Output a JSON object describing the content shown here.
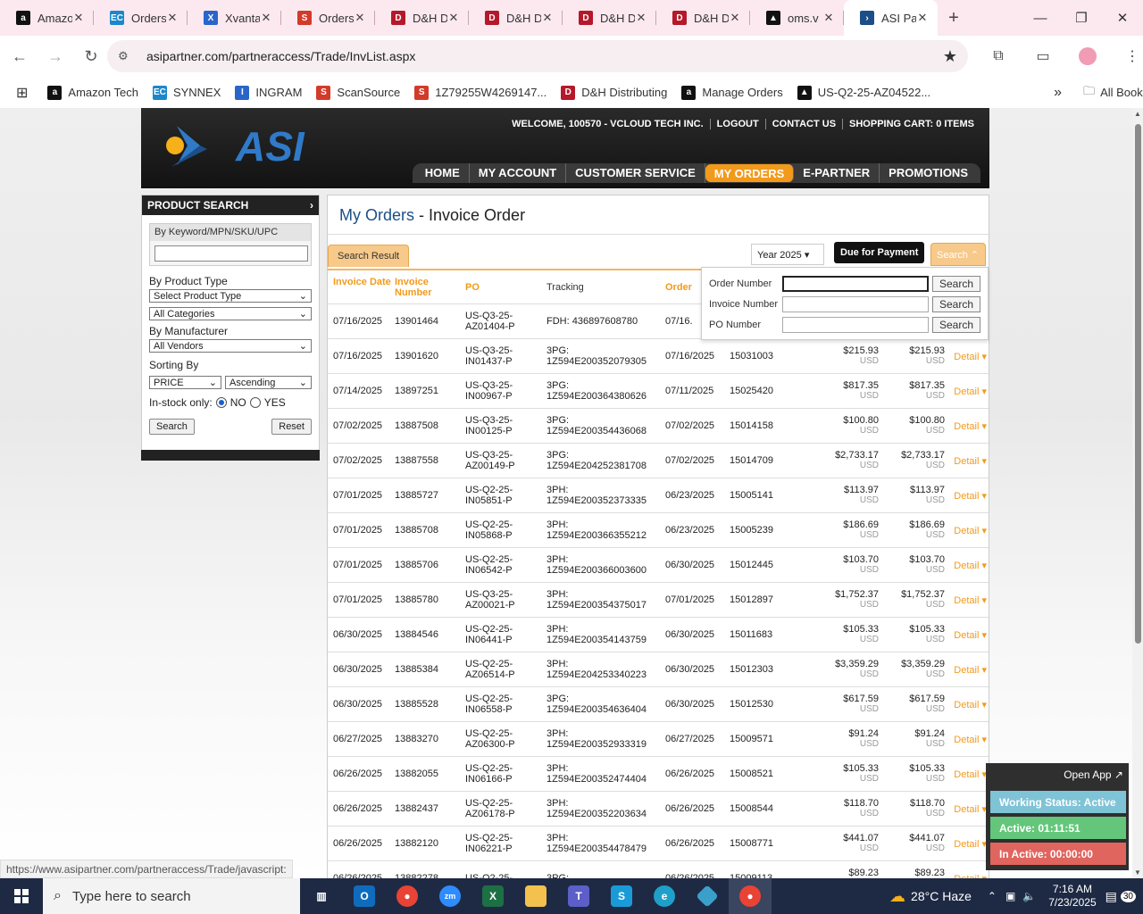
{
  "browser": {
    "tabs": [
      {
        "label": "Amazon",
        "icon": "amazon-icon",
        "color": "#111111",
        "glyph": "a"
      },
      {
        "label": "Orders",
        "icon": "ec-icon",
        "color": "#1d87c9",
        "glyph": "EC"
      },
      {
        "label": "Xvantage",
        "icon": "ingram-icon",
        "color": "#2a65c9",
        "glyph": "X"
      },
      {
        "label": "Orders",
        "icon": "scansource-icon",
        "color": "#d23b2a",
        "glyph": "S"
      },
      {
        "label": "D&H D",
        "icon": "dh-icon",
        "color": "#b5182a",
        "glyph": "D"
      },
      {
        "label": "D&H D",
        "icon": "dh-icon",
        "color": "#b5182a",
        "glyph": "D"
      },
      {
        "label": "D&H D",
        "icon": "dh-icon",
        "color": "#b5182a",
        "glyph": "D"
      },
      {
        "label": "D&H D",
        "icon": "dh-icon",
        "color": "#b5182a",
        "glyph": "D"
      },
      {
        "label": "oms.v",
        "icon": "oms-icon",
        "color": "#111111",
        "glyph": "▲"
      },
      {
        "label": "ASI Pa",
        "icon": "asi-icon",
        "color": "#1c4f87",
        "glyph": "›"
      }
    ],
    "url": "asipartner.com/partneraccess/Trade/InvList.aspx",
    "bookmarks": [
      {
        "label": "Amazon Tech",
        "color": "#111111",
        "glyph": "a"
      },
      {
        "label": "SYNNEX",
        "color": "#1d87c9",
        "glyph": "EC"
      },
      {
        "label": "INGRAM",
        "color": "#2a65c9",
        "glyph": "I"
      },
      {
        "label": "ScanSource",
        "color": "#d23b2a",
        "glyph": "S"
      },
      {
        "label": "1Z79255W4269147...",
        "color": "#d23b2a",
        "glyph": "S"
      },
      {
        "label": "D&H Distributing",
        "color": "#b5182a",
        "glyph": "D"
      },
      {
        "label": "Manage Orders",
        "color": "#111111",
        "glyph": "a"
      },
      {
        "label": "US-Q2-25-AZ04522...",
        "color": "#111111",
        "glyph": "▲"
      }
    ],
    "all_bookmarks": "All Bookmarks",
    "status_url": "https://www.asipartner.com/partneraccess/Trade/javascript:"
  },
  "header": {
    "logo_text": "ASI",
    "welcome": "WELCOME, 100570 - VCLOUD TECH INC.",
    "logout": "LOGOUT",
    "contact": "CONTACT US",
    "cart": "SHOPPING CART: 0 ITEMS",
    "nav": [
      "HOME",
      "MY ACCOUNT",
      "CUSTOMER SERVICE",
      "MY ORDERS",
      "E-PARTNER",
      "PROMOTIONS"
    ]
  },
  "sidebar": {
    "title": "PRODUCT SEARCH",
    "keyword_label": "By Keyword/MPN/SKU/UPC",
    "product_type_label": "By Product Type",
    "product_type_value": "Select Product Type",
    "category_value": "All Categories",
    "manufacturer_label": "By Manufacturer",
    "manufacturer_value": "All Vendors",
    "sorting_label": "Sorting By",
    "sort_field": "PRICE",
    "sort_order": "Ascending",
    "instock_label": "In-stock only:",
    "no_label": "NO",
    "yes_label": "YES",
    "search_btn": "Search",
    "reset_btn": "Reset"
  },
  "main": {
    "title_link": "My Orders",
    "title_sep": " - ",
    "title_rest": "Invoice Order",
    "result_tab": "Search Result",
    "year": "Year 2025",
    "due_btn": "Due for Payment",
    "search_tab": "Search",
    "columns": [
      "Invoice Date",
      "Invoice Number",
      "PO",
      "Tracking",
      "Order"
    ],
    "dropdown": {
      "order_label": "Order Number",
      "invoice_label": "Invoice Number",
      "po_label": "PO Number",
      "search": "Search"
    },
    "currency": "USD",
    "detail": "Detail",
    "rows": [
      {
        "date": "07/16/2025",
        "inv": "13901464",
        "po1": "US-Q3-25-",
        "po2": "AZ01404-P",
        "tr1": "FDH: 436897608780",
        "tr2": "",
        "odate": "07/16.",
        "ord": "",
        "amt": "",
        "amt2": ""
      },
      {
        "date": "07/16/2025",
        "inv": "13901620",
        "po1": "US-Q3-25-",
        "po2": "IN01437-P",
        "tr1": "3PG:",
        "tr2": "1Z594E200352079305",
        "odate": "07/16/2025",
        "ord": "15031003",
        "amt": "$215.93",
        "amt2": "$215.93"
      },
      {
        "date": "07/14/2025",
        "inv": "13897251",
        "po1": "US-Q3-25-",
        "po2": "IN00967-P",
        "tr1": "3PG:",
        "tr2": "1Z594E200364380626",
        "odate": "07/11/2025",
        "ord": "15025420",
        "amt": "$817.35",
        "amt2": "$817.35"
      },
      {
        "date": "07/02/2025",
        "inv": "13887508",
        "po1": "US-Q3-25-",
        "po2": "IN00125-P",
        "tr1": "3PG:",
        "tr2": "1Z594E200354436068",
        "odate": "07/02/2025",
        "ord": "15014158",
        "amt": "$100.80",
        "amt2": "$100.80"
      },
      {
        "date": "07/02/2025",
        "inv": "13887558",
        "po1": "US-Q3-25-",
        "po2": "AZ00149-P",
        "tr1": "3PG:",
        "tr2": "1Z594E204252381708",
        "odate": "07/02/2025",
        "ord": "15014709",
        "amt": "$2,733.17",
        "amt2": "$2,733.17"
      },
      {
        "date": "07/01/2025",
        "inv": "13885727",
        "po1": "US-Q2-25-",
        "po2": "IN05851-P",
        "tr1": "3PH:",
        "tr2": "1Z594E200352373335",
        "odate": "06/23/2025",
        "ord": "15005141",
        "amt": "$113.97",
        "amt2": "$113.97"
      },
      {
        "date": "07/01/2025",
        "inv": "13885708",
        "po1": "US-Q2-25-",
        "po2": "IN05868-P",
        "tr1": "3PH:",
        "tr2": "1Z594E200366355212",
        "odate": "06/23/2025",
        "ord": "15005239",
        "amt": "$186.69",
        "amt2": "$186.69"
      },
      {
        "date": "07/01/2025",
        "inv": "13885706",
        "po1": "US-Q2-25-",
        "po2": "IN06542-P",
        "tr1": "3PH:",
        "tr2": "1Z594E200366003600",
        "odate": "06/30/2025",
        "ord": "15012445",
        "amt": "$103.70",
        "amt2": "$103.70"
      },
      {
        "date": "07/01/2025",
        "inv": "13885780",
        "po1": "US-Q3-25-",
        "po2": "AZ00021-P",
        "tr1": "3PH:",
        "tr2": "1Z594E200354375017",
        "odate": "07/01/2025",
        "ord": "15012897",
        "amt": "$1,752.37",
        "amt2": "$1,752.37"
      },
      {
        "date": "06/30/2025",
        "inv": "13884546",
        "po1": "US-Q2-25-",
        "po2": "IN06441-P",
        "tr1": "3PH:",
        "tr2": "1Z594E200354143759",
        "odate": "06/30/2025",
        "ord": "15011683",
        "amt": "$105.33",
        "amt2": "$105.33"
      },
      {
        "date": "06/30/2025",
        "inv": "13885384",
        "po1": "US-Q2-25-",
        "po2": "AZ06514-P",
        "tr1": "3PH:",
        "tr2": "1Z594E204253340223",
        "odate": "06/30/2025",
        "ord": "15012303",
        "amt": "$3,359.29",
        "amt2": "$3,359.29"
      },
      {
        "date": "06/30/2025",
        "inv": "13885528",
        "po1": "US-Q2-25-",
        "po2": "IN06558-P",
        "tr1": "3PG:",
        "tr2": "1Z594E200354636404",
        "odate": "06/30/2025",
        "ord": "15012530",
        "amt": "$617.59",
        "amt2": "$617.59"
      },
      {
        "date": "06/27/2025",
        "inv": "13883270",
        "po1": "US-Q2-25-",
        "po2": "AZ06300-P",
        "tr1": "3PH:",
        "tr2": "1Z594E200352933319",
        "odate": "06/27/2025",
        "ord": "15009571",
        "amt": "$91.24",
        "amt2": "$91.24"
      },
      {
        "date": "06/26/2025",
        "inv": "13882055",
        "po1": "US-Q2-25-",
        "po2": "IN06166-P",
        "tr1": "3PH:",
        "tr2": "1Z594E200352474404",
        "odate": "06/26/2025",
        "ord": "15008521",
        "amt": "$105.33",
        "amt2": "$105.33"
      },
      {
        "date": "06/26/2025",
        "inv": "13882437",
        "po1": "US-Q2-25-",
        "po2": "AZ06178-P",
        "tr1": "3PH:",
        "tr2": "1Z594E200352203634",
        "odate": "06/26/2025",
        "ord": "15008544",
        "amt": "$118.70",
        "amt2": "$118.70"
      },
      {
        "date": "06/26/2025",
        "inv": "13882120",
        "po1": "US-Q2-25-",
        "po2": "IN06221-P",
        "tr1": "3PH:",
        "tr2": "1Z594E200354478479",
        "odate": "06/26/2025",
        "ord": "15008771",
        "amt": "$441.07",
        "amt2": "$441.07"
      },
      {
        "date": "06/26/2025",
        "inv": "13882278",
        "po1": "US-Q2-25-",
        "po2": "",
        "tr1": "3PG:",
        "tr2": "",
        "odate": "06/26/2025",
        "ord": "15009113",
        "amt": "$89.23",
        "amt2": "$89.23"
      }
    ]
  },
  "widget": {
    "open_app": "Open App ↗",
    "working": "Working Status: Active",
    "active": "Active: 01:11:51",
    "inactive": "In Active: 00:00:00",
    "colors": {
      "working": "#7fc3d6",
      "active": "#63c67a",
      "inactive": "#e0655f"
    }
  },
  "taskbar": {
    "search_placeholder": "Type here to search",
    "weather": "28°C  Haze",
    "time": "7:16 AM",
    "date": "7/23/2025",
    "notif_count": "30"
  },
  "colors": {
    "accent": "#f29a1b",
    "brand_blue": "#1c4f87"
  }
}
